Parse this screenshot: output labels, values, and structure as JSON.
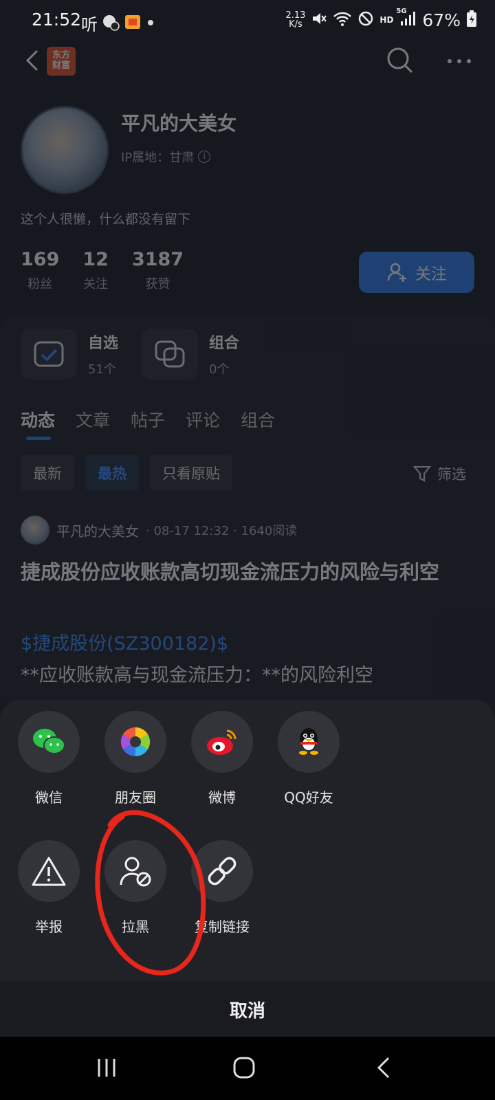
{
  "status_bar": {
    "time": "21:52",
    "net_speed_top": "2.13",
    "net_speed_bottom": "K/s",
    "hd": "HD",
    "signal": "5G",
    "battery": "67%",
    "app_icon_text": "听"
  },
  "nav": {
    "logo_text_line1": "东方",
    "logo_text_line2": "财富"
  },
  "profile": {
    "name": "平凡的大美女",
    "ip_label": "IP属地：甘肃",
    "bio": "这个人很懒，什么都没有留下",
    "stats": [
      {
        "num": "169",
        "label": "粉丝"
      },
      {
        "num": "12",
        "label": "关注"
      },
      {
        "num": "3187",
        "label": "获赞"
      }
    ],
    "follow_label": "关注"
  },
  "shortcuts": [
    {
      "title": "自选",
      "sub": "51个"
    },
    {
      "title": "组合",
      "sub": "0个"
    }
  ],
  "tabs": [
    "动态",
    "文章",
    "帖子",
    "评论",
    "组合"
  ],
  "chips": [
    "最新",
    "最热",
    "只看原贴"
  ],
  "filter_label": "筛选",
  "post": {
    "author": "平凡的大美女",
    "meta": " · 08-17 12:32 · 1640阅读",
    "title": "捷成股份应收账款高切现金流压力的风险与利空",
    "tag": "$捷成股份(SZ300182)$",
    "body": "**应收账款高与现金流压力：**的风险利空"
  },
  "share_sheet": {
    "row1": [
      {
        "label": "微信",
        "icon": "wechat-icon"
      },
      {
        "label": "朋友圈",
        "icon": "moments-icon"
      },
      {
        "label": "微博",
        "icon": "weibo-icon"
      },
      {
        "label": "QQ好友",
        "icon": "qq-icon"
      }
    ],
    "row2": [
      {
        "label": "举报",
        "icon": "warning-icon"
      },
      {
        "label": "拉黑",
        "icon": "block-user-icon"
      },
      {
        "label": "复制链接",
        "icon": "link-icon"
      }
    ],
    "cancel": "取消"
  },
  "colors": {
    "accent": "#2f78e6",
    "annotation": "#e8261c",
    "sheet_bg": "#212227"
  }
}
